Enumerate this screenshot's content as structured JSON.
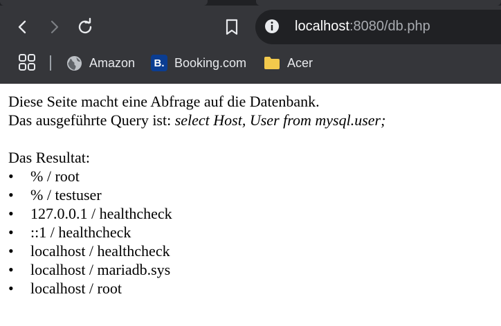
{
  "browser": {
    "url_host": "localhost",
    "url_rest": ":8080/db.php",
    "bookmarks": [
      {
        "label": "Amazon",
        "icon": "globe-icon"
      },
      {
        "label": "Booking.com",
        "icon": "booking-logo",
        "logo_letter": "B."
      },
      {
        "label": "Acer",
        "icon": "folder-icon"
      }
    ],
    "colors": {
      "toolbar": "#35363a",
      "omnibox": "#202124",
      "folder": "#f2c94c",
      "booking": "#0b3d91"
    }
  },
  "page": {
    "intro_line": "Diese Seite macht eine Abfrage auf die Datenbank.",
    "query_prefix": "Das ausgeführte Query ist: ",
    "query_text": "select Host, User from mysql.user;",
    "result_heading": "Das Resultat:",
    "bullet_char": "•",
    "results": [
      "% / root",
      "% / testuser",
      "127.0.0.1 / healthcheck",
      "::1 / healthcheck",
      "localhost / healthcheck",
      "localhost / mariadb.sys",
      "localhost / root"
    ]
  }
}
